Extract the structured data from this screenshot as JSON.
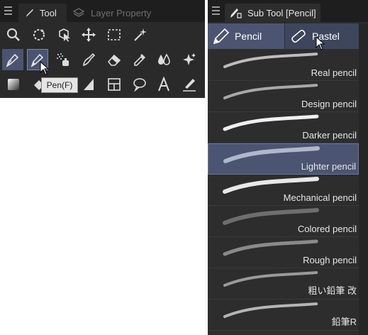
{
  "tool_panel": {
    "tabs": [
      {
        "label": "Tool",
        "active": true
      },
      {
        "label": "Layer Property",
        "active": false
      }
    ],
    "tooltip": "Pen(F)",
    "tools": [
      {
        "icon": "zoom-icon",
        "selected": false
      },
      {
        "icon": "rotate-icon",
        "selected": false
      },
      {
        "icon": "object-select-icon",
        "selected": false
      },
      {
        "icon": "move-icon",
        "selected": false
      },
      {
        "icon": "marquee-selection-icon",
        "selected": false
      },
      {
        "icon": "magic-wand-icon",
        "selected": false
      },
      {
        "icon": "pen-icon",
        "selected": true
      },
      {
        "icon": "pencil-icon",
        "selected": true
      },
      {
        "icon": "airbrush-icon",
        "selected": false
      },
      {
        "icon": "brush-icon",
        "selected": false
      },
      {
        "icon": "eraser-icon",
        "selected": false
      },
      {
        "icon": "eyedropper-icon",
        "selected": false
      },
      {
        "icon": "blend-icon",
        "selected": false
      },
      {
        "icon": "sparkle-icon",
        "selected": false
      },
      {
        "icon": "gradient-icon",
        "selected": false
      },
      {
        "icon": "fill-icon",
        "selected": false
      },
      {
        "icon": "figure-icon",
        "selected": false
      },
      {
        "icon": "frame-border-icon",
        "selected": false
      },
      {
        "icon": "balloon-icon",
        "selected": false
      },
      {
        "icon": "text-icon",
        "selected": false
      },
      {
        "icon": "correct-line-icon",
        "selected": false
      }
    ]
  },
  "sub_tool_panel": {
    "title": "Sub Tool [Pencil]",
    "groups": [
      {
        "label": "Pencil",
        "icon": "pencil-icon",
        "active": true
      },
      {
        "label": "Pastel",
        "icon": "pastel-icon",
        "active": false
      }
    ],
    "brushes": [
      {
        "name": "Real pencil",
        "selected": false
      },
      {
        "name": "Design pencil",
        "selected": false
      },
      {
        "name": "Darker pencil",
        "selected": false
      },
      {
        "name": "Lighter pencil",
        "selected": true
      },
      {
        "name": "Mechanical pencil",
        "selected": false
      },
      {
        "name": "Colored pencil",
        "selected": false
      },
      {
        "name": "Rough pencil",
        "selected": false
      },
      {
        "name": "粗い鉛筆 改",
        "selected": false
      },
      {
        "name": "鉛筆R",
        "selected": false
      }
    ]
  },
  "colors": {
    "panel_bg": "#2a2a2a",
    "header_bg": "#1e1e1e",
    "selection": "#4b5572",
    "text": "#e6e6e6"
  }
}
